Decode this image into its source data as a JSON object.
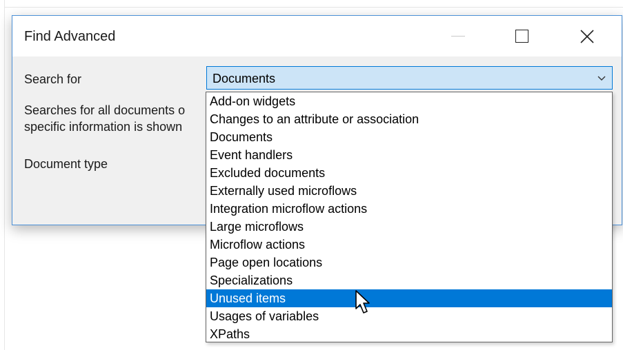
{
  "window": {
    "title": "Find Advanced"
  },
  "form": {
    "search_for_label": "Search for",
    "search_for_value": "Documents",
    "description_line1": "Searches for all documents o",
    "description_line2": "specific information is shown",
    "document_type_label": "Document type"
  },
  "dropdown": {
    "items": [
      "Add-on widgets",
      "Changes to an attribute or association",
      "Documents",
      "Event handlers",
      "Excluded documents",
      "Externally used microflows",
      "Integration microflow actions",
      "Large microflows",
      "Microflow actions",
      "Page open locations",
      "Specializations",
      "Unused items",
      "Usages of variables",
      "XPaths"
    ],
    "highlighted_item": "Unused items"
  },
  "colors": {
    "accent": "#0078d7",
    "combo_bg": "#cce4f7",
    "window_border": "#4a8fd6"
  },
  "icons": {
    "minimize": "minimize-icon",
    "maximize": "maximize-icon",
    "close": "close-icon",
    "dropdown": "chevron-down-icon",
    "cursor": "mouse-pointer-icon"
  }
}
